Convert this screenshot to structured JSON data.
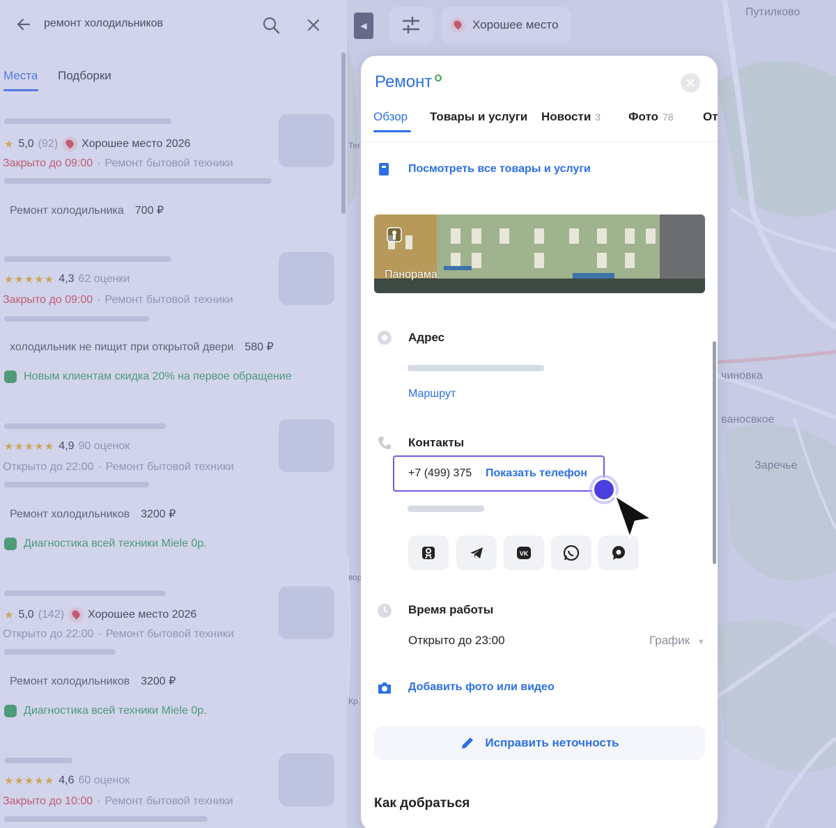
{
  "search": {
    "query": "ремонт холодильников",
    "tabs": [
      "Места",
      "Подборки"
    ]
  },
  "results": [
    {
      "rating": "5,0",
      "count": "(92)",
      "badge": "Хорошее место 2026",
      "status": "Закрыто до 09:00",
      "category": "Ремонт бытовой техники",
      "service": "Ремонт холодильника",
      "price": "700 ₽"
    },
    {
      "rating": "4,3",
      "count": "62 оценки",
      "status": "Закрыто до 09:00",
      "category": "Ремонт бытовой техники",
      "service": "холодильник не пищит при открытой двери",
      "price": "580 ₽",
      "promo": "Новым клиентам скидка 20% на первое обращение"
    },
    {
      "rating": "4,9",
      "count": "90 оценок",
      "status": "Открыто до 22:00",
      "category": "Ремонт бытовой техники",
      "service": "Ремонт холодильников",
      "price": "3200 ₽",
      "promo": "Диагностика всей техники Miele 0р."
    },
    {
      "rating": "5,0",
      "count": "(142)",
      "badge": "Хорошее место 2026",
      "status": "Открыто до 22:00",
      "category": "Ремонт бытовой техники",
      "service": "Ремонт холодильников",
      "price": "3200 ₽",
      "promo": "Диагностика всей техники Miele 0р."
    },
    {
      "rating": "4,6",
      "count": "60 оценок",
      "status": "Закрыто до 10:00",
      "category": "Ремонт бытовой техники"
    }
  ],
  "map": {
    "top_badge": "Хорошее место",
    "labels": [
      "Путилково",
      "чиновка",
      "ваносвкое",
      "Заречье",
      "Теп",
      "Кр",
      "вор"
    ]
  },
  "card": {
    "title": "Ремонт",
    "tabs": [
      {
        "label": "Обзор",
        "count": ""
      },
      {
        "label": "Товары и услуги",
        "count": ""
      },
      {
        "label": "Новости",
        "count": "3"
      },
      {
        "label": "Фото",
        "count": "78"
      },
      {
        "label": "От",
        "count": ""
      }
    ],
    "all_goods_link": "Посмотреть все товары и услуги",
    "panorama_label": "Панорама",
    "address_label": "Адрес",
    "route_link": "Маршрут",
    "contacts_label": "Контакты",
    "phone_partial": "+7 (499) 375",
    "show_phone": "Показать телефон",
    "socials": [
      "ok",
      "telegram",
      "vk",
      "whatsapp",
      "chat"
    ],
    "hours_label": "Время работы",
    "hours_value": "Открыто до 23:00",
    "schedule_link": "График",
    "add_photo_link": "Добавить фото или видео",
    "fix_button": "Исправить неточность",
    "how_to_get": "Как добраться"
  },
  "colors": {
    "accent": "#2c6fe6",
    "closed": "#e04c4c",
    "promo": "#3aa557",
    "star": "#f5b826",
    "cursor_dot": "#4b3fe0",
    "highlight_border": "#6b5de6"
  }
}
